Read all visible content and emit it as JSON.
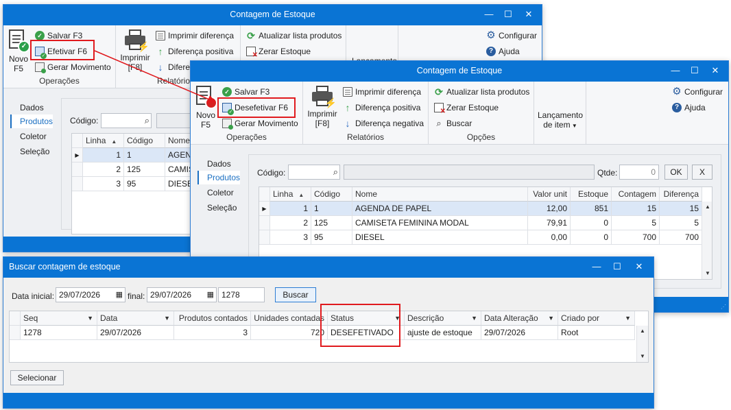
{
  "win1": {
    "title": "Contagem de Estoque",
    "ribbon": {
      "novo": "Novo",
      "novo_key": "F5",
      "salvar": "Salvar F3",
      "efetivar": "Efetivar F6",
      "gerar": "Gerar Movimento",
      "grp_operacoes": "Operações",
      "imprimir": "Imprimir",
      "imprimir_key": "[F8]",
      "imprimir_diferenca": "Imprimir diferença",
      "diferenca_positiva": "Diferença positiva",
      "diferenca_negativa_partial": "Difere",
      "grp_relatorios_partial": "Relatório",
      "atualizar": "Atualizar lista produtos",
      "zerar": "Zerar Estoque",
      "lancamento_partial": "Lançamento",
      "configurar": "Configurar",
      "ajuda": "Ajuda"
    },
    "sidebar": [
      "Dados",
      "Produtos",
      "Coletor",
      "Seleção"
    ],
    "codigo_label": "Código:",
    "grid": {
      "headers": [
        "Linha",
        "Código",
        "Nome"
      ],
      "rows": [
        {
          "linha": "1",
          "codigo": "1",
          "nome": "AGEND"
        },
        {
          "linha": "2",
          "codigo": "125",
          "nome": "CAMIS"
        },
        {
          "linha": "3",
          "codigo": "95",
          "nome": "DIESEL"
        }
      ]
    }
  },
  "win2": {
    "title": "Contagem de Estoque",
    "ribbon": {
      "novo": "Novo",
      "novo_key": "F5",
      "salvar": "Salvar F3",
      "desefetivar": "Desefetivar F6",
      "gerar": "Gerar Movimento",
      "grp_operacoes": "Operações",
      "imprimir": "Imprimir",
      "imprimir_key": "[F8]",
      "imprimir_diferenca": "Imprimir diferença",
      "diferenca_positiva": "Diferença positiva",
      "diferenca_negativa": "Diferença negativa",
      "grp_relatorios": "Relatórios",
      "atualizar": "Atualizar lista produtos",
      "zerar": "Zerar Estoque",
      "buscar": "Buscar",
      "grp_opcoes": "Opções",
      "lancamento": "Lançamento",
      "de_item": "de item",
      "configurar": "Configurar",
      "ajuda": "Ajuda"
    },
    "sidebar": [
      "Dados",
      "Produtos",
      "Coletor",
      "Seleção"
    ],
    "codigo_label": "Código:",
    "qtde_label": "Qtde:",
    "qtde_value": "0",
    "ok": "OK",
    "x": "X",
    "grid": {
      "headers": [
        "Linha",
        "Código",
        "Nome",
        "Valor unit",
        "Estoque",
        "Contagem",
        "Diferença"
      ],
      "rows": [
        {
          "linha": "1",
          "codigo": "1",
          "nome": "AGENDA DE PAPEL",
          "valor": "12,00",
          "estoque": "851",
          "contagem": "15",
          "diferenca": "15"
        },
        {
          "linha": "2",
          "codigo": "125",
          "nome": "CAMISETA FEMININA MODAL",
          "valor": "79,91",
          "estoque": "0",
          "contagem": "5",
          "diferenca": "5"
        },
        {
          "linha": "3",
          "codigo": "95",
          "nome": "DIESEL",
          "valor": "0,00",
          "estoque": "0",
          "contagem": "700",
          "diferenca": "700"
        }
      ]
    }
  },
  "win3": {
    "title": "Buscar contagem de estoque",
    "data_inicial_label": "Data inicial:",
    "data_inicial": "29/07/2026",
    "final_label": "final:",
    "data_final": "29/07/2026",
    "seq_value": "1278",
    "buscar": "Buscar",
    "grid": {
      "headers": [
        "Seq",
        "Data",
        "Produtos contados",
        "Unidades contadas",
        "Status",
        "Descrição",
        "Data Alteração",
        "Criado por"
      ],
      "rows": [
        {
          "seq": "1278",
          "data": "29/07/2026",
          "produtos": "3",
          "unidades": "720",
          "status": "DESEFETIVADO",
          "descricao": "ajuste de estoque",
          "alteracao": "29/07/2026",
          "criado": "Root"
        }
      ]
    },
    "selecionar": "Selecionar"
  },
  "colors": {
    "titlebar": "#0a74d4",
    "highlight": "#e0191d",
    "accent_link": "#1a6fc2"
  }
}
